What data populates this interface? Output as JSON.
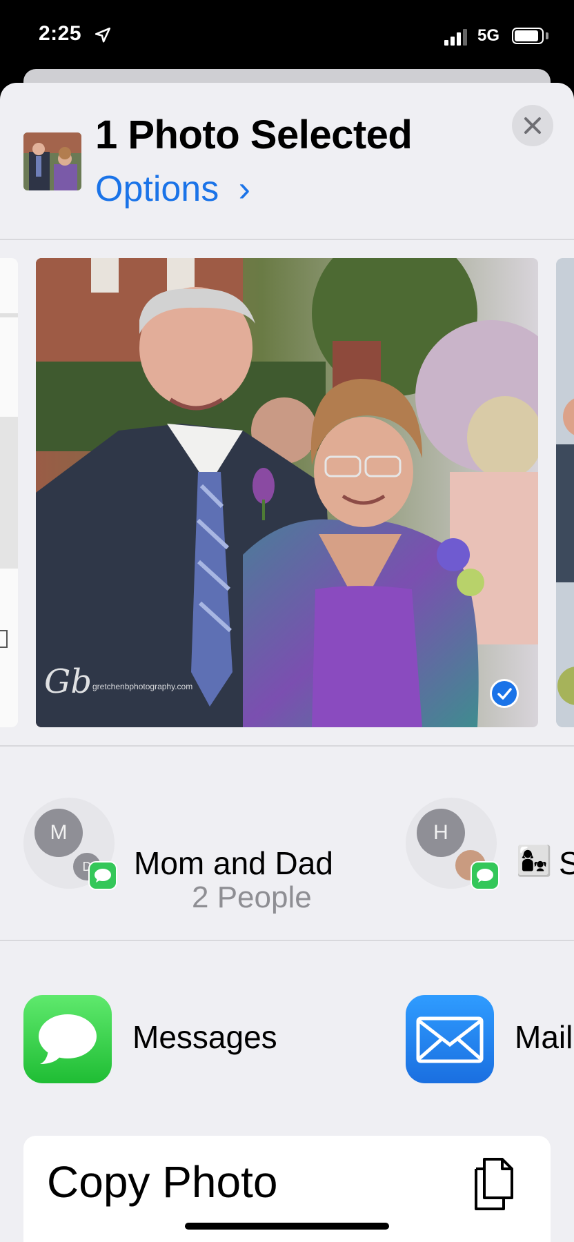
{
  "status_bar": {
    "time": "2:25",
    "network": "5G",
    "location_icon": "location-arrow-icon",
    "signal_icon": "cellular-signal-icon",
    "battery_icon": "battery-icon"
  },
  "header": {
    "title": "1 Photo Selected",
    "options_label": "Options",
    "options_chevron": "›",
    "close_icon": "close-icon",
    "close_glyph": "✕"
  },
  "photo": {
    "watermark_signature": "Gb",
    "watermark_url": "gretchenbphotography.com",
    "selected": true
  },
  "people": [
    {
      "name": "Mom and Dad",
      "subtitle": "2 People",
      "avatar_primary": "M",
      "avatar_secondary": "D"
    },
    {
      "name": "S",
      "emoji": "👩‍👧",
      "avatar_primary": "H"
    }
  ],
  "apps": [
    {
      "label": "Messages",
      "icon": "messages-icon"
    },
    {
      "label": "Mail",
      "icon": "mail-icon"
    }
  ],
  "actions": [
    {
      "label": "Copy Photo",
      "icon": "copy-icon"
    }
  ],
  "colors": {
    "accent": "#1a73e8",
    "messages_green": "#34c759",
    "mail_blue": "#1e8cf0"
  }
}
